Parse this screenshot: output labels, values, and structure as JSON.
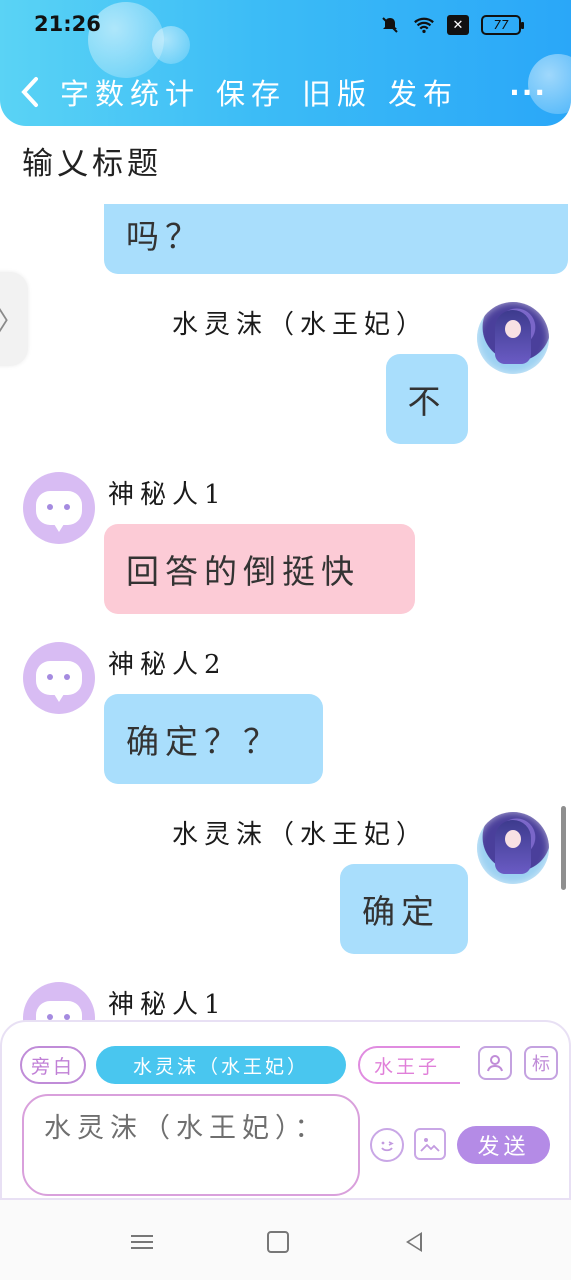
{
  "status_bar": {
    "time": "21:26",
    "battery": "77",
    "mute_icon": "bell-off-icon",
    "wifi_icon": "wifi-icon",
    "x_icon": "x-box-icon"
  },
  "toolbar": {
    "back_icon": "chevron-left-icon",
    "word_count": "字数统计",
    "save": "保存",
    "old_version": "旧版",
    "publish": "发布",
    "more": "···"
  },
  "title": {
    "placeholder": "输乂标题"
  },
  "side_handle": {
    "icon": "〉"
  },
  "messages": [
    {
      "kind": "right-partial",
      "text": "吗？"
    },
    {
      "sender": "水灵沫（水王妃）",
      "text": "不",
      "side": "right"
    },
    {
      "sender": "神秘人1",
      "text": "回答的倒挺快",
      "side": "left"
    },
    {
      "sender": "神秘人2",
      "text": "确定？？",
      "side": "left"
    },
    {
      "sender": "水灵沫（水王妃）",
      "text": "确定",
      "side": "right"
    },
    {
      "sender": "神秘人1",
      "text": "",
      "side": "left"
    }
  ],
  "input_panel": {
    "roles": {
      "aside": "旁白",
      "active": "水灵沫（水王妃）",
      "other": "水王子"
    },
    "contacts_icon": "person-icon",
    "tag_label": "标",
    "input_value": "水灵沫（水王妃）：",
    "emoji_icon": "smiley-icon",
    "image_icon": "image-icon",
    "send": "发送"
  },
  "nav": {
    "menu_icon": "menu-icon",
    "home_icon": "home-icon",
    "back_icon": "back-triangle-icon"
  },
  "colors": {
    "header": "#3cbcf6",
    "bubble_blue": "#a9defc",
    "bubble_pink": "#fccbd6",
    "accent_purple": "#b48be6"
  }
}
